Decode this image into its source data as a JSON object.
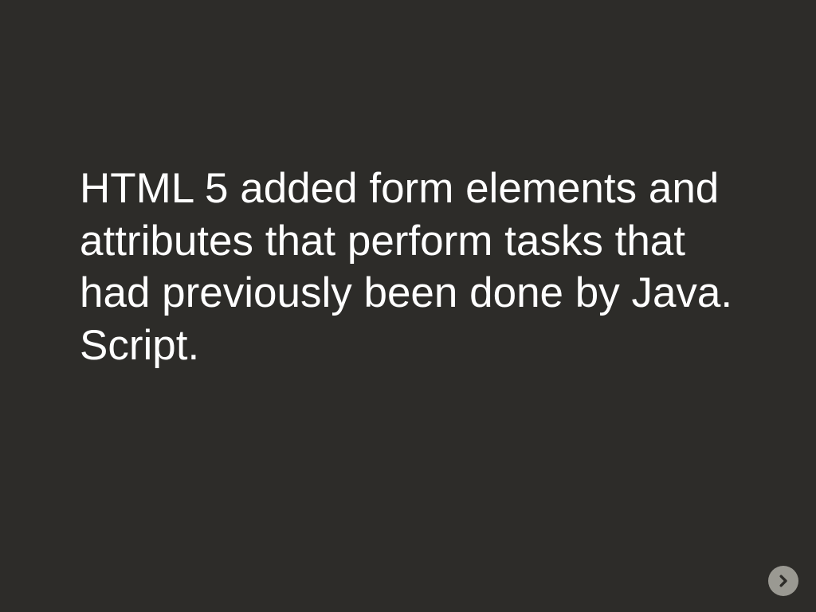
{
  "slide": {
    "body": "HTML 5 added form elements and attributes that perform tasks that had previously been done by Java. Script."
  },
  "nav": {
    "next_icon": "arrow-right"
  },
  "colors": {
    "background": "#2d2c29",
    "text": "#ffffff",
    "button_bg": "#9a9992",
    "button_fg": "#2d2c29"
  }
}
